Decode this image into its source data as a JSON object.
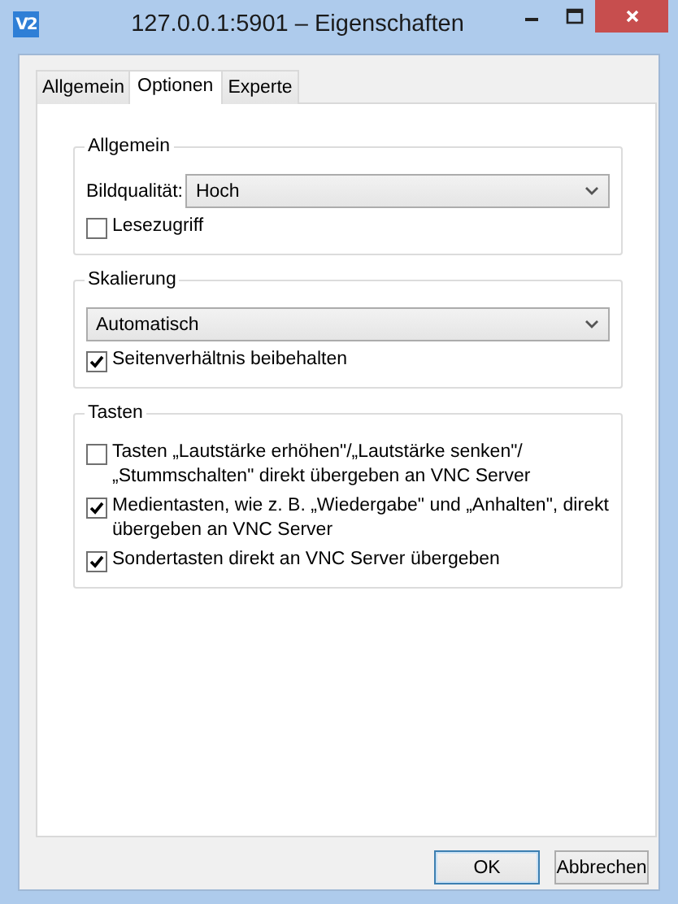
{
  "window": {
    "logo": "V2",
    "title": "127.0.0.1:5901 – Eigenschaften"
  },
  "tabs": [
    {
      "label": "Allgemein",
      "selected": false
    },
    {
      "label": "Optionen",
      "selected": true
    },
    {
      "label": "Experte",
      "selected": false
    }
  ],
  "groups": [
    {
      "title": "Allgemein",
      "items": [
        {
          "kind": "select",
          "label": "Bildqualität:",
          "value": "Hoch"
        },
        {
          "kind": "checkbox",
          "label": "Lesezugriff",
          "checked": false
        }
      ]
    },
    {
      "title": "Skalierung",
      "items": [
        {
          "kind": "select",
          "value": "Automatisch"
        },
        {
          "kind": "checkbox",
          "label": "Seitenverhältnis beibehalten",
          "checked": true
        }
      ]
    },
    {
      "title": "Tasten",
      "items": [
        {
          "kind": "checkbox",
          "label": "Tasten „Lautstärke erhöhen\"/„Lautstärke senken\"/„Stummschalten\" direkt übergeben an VNC Server",
          "checked": false
        },
        {
          "kind": "checkbox",
          "label": "Medientasten, wie z. B. „Wiedergabe\" und „Anhalten\", direkt übergeben an VNC Server",
          "checked": true
        },
        {
          "kind": "checkbox",
          "label": "Sondertasten direkt an VNC Server übergeben",
          "checked": true
        }
      ]
    }
  ],
  "buttons": [
    {
      "label": "OK",
      "default": true
    },
    {
      "label": "Abbrechen",
      "default": false
    }
  ]
}
